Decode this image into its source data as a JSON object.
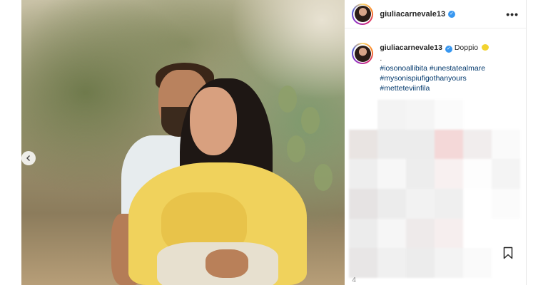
{
  "post": {
    "username": "giuliacarnevale13",
    "caption": {
      "username": "giuliacarnevale13",
      "text": "Doppio",
      "dot": ".",
      "hashtags": [
        "#iosonoallibita #unestatealmare",
        "#mysonispiufigothanyours",
        "#metteteviinfila"
      ]
    },
    "likes_partial": "4",
    "icons": {
      "verified": "verified-badge-icon",
      "more": "more-options-icon",
      "bookmark": "bookmark-icon",
      "prev": "chevron-left-icon",
      "emoji": "lemon-emoji-icon"
    },
    "colors": {
      "verified": "#3897f0",
      "hashtag": "#00376b",
      "text": "#262626"
    }
  }
}
